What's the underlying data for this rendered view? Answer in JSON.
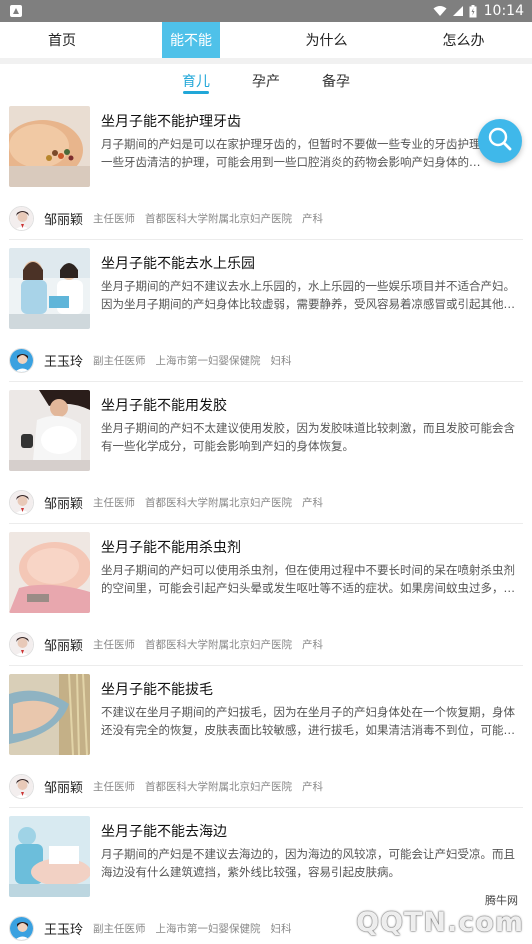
{
  "status_bar": {
    "time": "10:14"
  },
  "top_nav": {
    "tabs": [
      {
        "label": "首页"
      },
      {
        "label": "能不能"
      },
      {
        "label": "为什么"
      },
      {
        "label": "怎么办"
      }
    ],
    "active_index": 1
  },
  "sub_tabs": {
    "tabs": [
      {
        "label": "育儿"
      },
      {
        "label": "孕产"
      },
      {
        "label": "备孕"
      }
    ],
    "active_index": 0
  },
  "articles": [
    {
      "title": "坐月子能不能护理牙齿",
      "summary": "月子期间的产妇是可以在家护理牙齿的，但暂时不要做一些专业的牙齿护理，类似一些牙齿清洁的护理，可能会用到一些口腔消炎的药物会影响产妇身体的…",
      "author": "邹丽颖",
      "position": "主任医师",
      "hospital": "首都医科大学附属北京妇产医院",
      "department": "产科"
    },
    {
      "title": "坐月子能不能去水上乐园",
      "summary": "坐月子期间的产妇不建议去水上乐园的，水上乐园的一些娱乐项目并不适合产妇。因为坐月子期间的产妇身体比较虚弱，需要静养，受风容易着凉感冒或引起其他…",
      "author": "王玉玲",
      "position": "副主任医师",
      "hospital": "上海市第一妇婴保健院",
      "department": "妇科"
    },
    {
      "title": "坐月子能不能用发胶",
      "summary": "坐月子期间的产妇不太建议使用发胶，因为发胶味道比较刺激，而且发胶可能会含有一些化学成分，可能会影响到产妇的身体恢复。",
      "author": "邹丽颖",
      "position": "主任医师",
      "hospital": "首都医科大学附属北京妇产医院",
      "department": "产科"
    },
    {
      "title": "坐月子能不能用杀虫剂",
      "summary": "坐月子期间的产妇可以使用杀虫剂，但在使用过程中不要长时间的呆在喷射杀虫剂的空间里，可能会引起产妇头晕或发生呕吐等不适的症状。如果房间蚊虫过多，…",
      "author": "邹丽颖",
      "position": "主任医师",
      "hospital": "首都医科大学附属北京妇产医院",
      "department": "产科"
    },
    {
      "title": "坐月子能不能拔毛",
      "summary": "不建议在坐月子期间的产妇拔毛，因为在坐月子的产妇身体处在一个恢复期，身体还没有完全的恢复，皮肤表面比较敏感，进行拔毛，如果清洁消毒不到位，可能…",
      "author": "邹丽颖",
      "position": "主任医师",
      "hospital": "首都医科大学附属北京妇产医院",
      "department": "产科"
    },
    {
      "title": "坐月子能不能去海边",
      "summary": "月子期间的产妇是不建议去海边的，因为海边的风较凉，可能会让产妇受凉。而且海边没有什么建筑遮挡，紫外线比较强，容易引起皮肤病。",
      "author": "王玉玲",
      "position": "副主任医师",
      "hospital": "上海市第一妇婴保健院",
      "department": "妇科"
    }
  ],
  "watermark": {
    "text": "腾牛网",
    "logo": "QQTN.com"
  },
  "colors": {
    "accent": "#4fc1e9",
    "sub_tab_active": "#21a7d8",
    "status_bar": "#7f7f7f"
  }
}
